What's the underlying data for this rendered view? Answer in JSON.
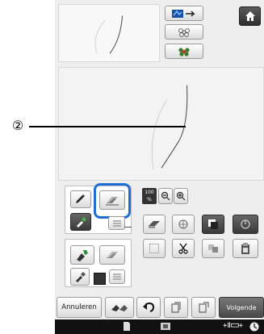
{
  "callout": {
    "number": "②"
  },
  "zoom": {
    "level_label": "100",
    "unit": "%"
  },
  "bottom_bar": {
    "cancel_label": "Annuleren",
    "next_label": "Volgende"
  },
  "status": {
    "tension_label": "+ǁ⊏⊐+"
  },
  "colors": {
    "highlight": "#1f6fd6",
    "screen_bg": "#eeeeee",
    "status_bar": "#111111"
  }
}
